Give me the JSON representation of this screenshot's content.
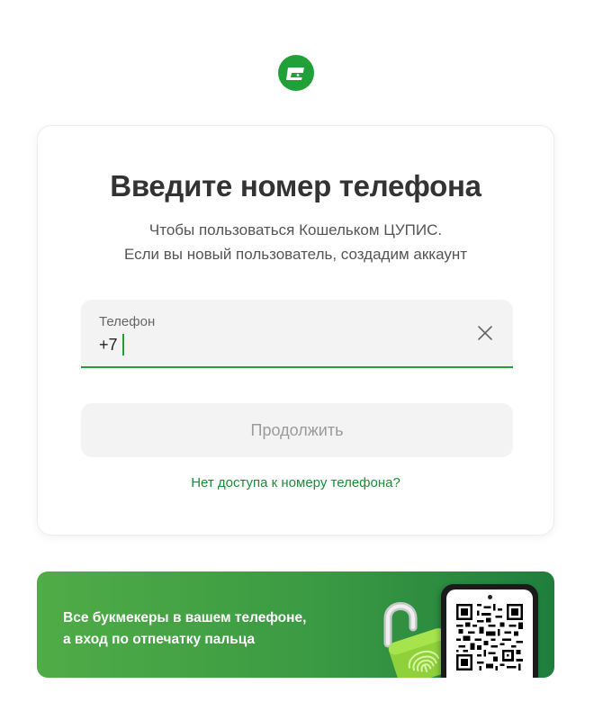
{
  "app": {
    "logo_icon": "wallet-logo-icon",
    "brand_color": "#21a038"
  },
  "login": {
    "title": "Введите номер телефона",
    "subtitle_line1": "Чтобы пользоваться Кошельком ЦУПИС.",
    "subtitle_line2": "Если вы новый пользователь, создадим аккаунт",
    "phone_field": {
      "label": "Телефон",
      "value": "+7",
      "clear_icon": "close-icon"
    },
    "continue_label": "Продолжить",
    "no_access_link": "Нет доступа к номеру телефона?"
  },
  "banner": {
    "line1": "Все букмекеры в вашем телефоне,",
    "line2": "а вход по отпечатку пальца",
    "lock_icon": "fingerprint-lock-icon",
    "qr_icon": "qr-code-icon",
    "gradient_start": "#4fac46",
    "gradient_end": "#1f7e3d"
  }
}
